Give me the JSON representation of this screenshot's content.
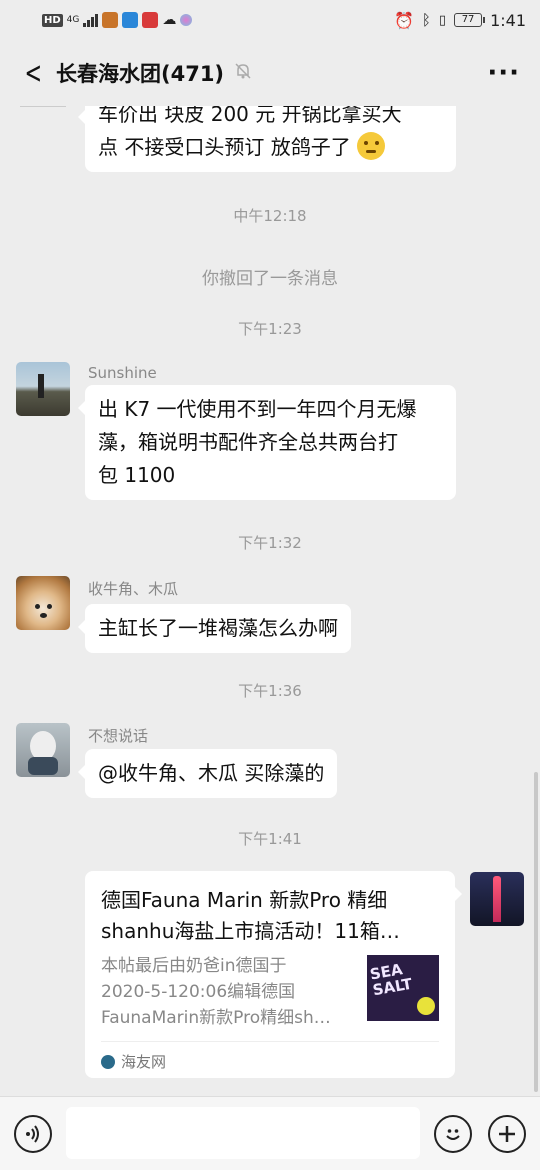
{
  "status_bar": {
    "hd": "HD",
    "net": "4G",
    "battery": "77",
    "time": "1:41"
  },
  "header": {
    "title": "长春海水团(471)",
    "more": "···"
  },
  "messages": {
    "m0_line1": "车价出   块皮 200 元  开锅比拿买大",
    "m0_line2": "点  不接受口头预订 放鸽子了",
    "t1": "中午12:18",
    "recall": "你撤回了一条消息",
    "t2": "下午1:23",
    "m1_nick": "Sunshine",
    "m1_line1": "出 K7 一代使用不到一年四个月无爆",
    "m1_line2": "藻，箱说明书配件齐全总共两台打",
    "m1_line3": "包 1100",
    "t3": "下午1:32",
    "m2_nick": "收牛角、木瓜",
    "m2_text": "主缸长了一堆褐藻怎么办啊",
    "t4": "下午1:36",
    "m3_nick": "不想说话",
    "m3_text": "@收牛角、木瓜  买除藻的",
    "t5": "下午1:41"
  },
  "card": {
    "title_line1": "德国Fauna Marin 新款Pro 精细",
    "title_line2": "shanhu海盐上市搞活动！11箱…",
    "desc_line1": "本帖最后由奶爸in德国于",
    "desc_line2": "2020-5-120:06编辑德国",
    "desc_line3": "FaunaMarin新款Pro精细sh…",
    "thumb_text": "SEA SALT",
    "source": "海友网"
  },
  "input": {
    "placeholder": ""
  },
  "colors": {
    "background": "#ededed",
    "bubble": "#ffffff",
    "timestamp": "#999999"
  }
}
